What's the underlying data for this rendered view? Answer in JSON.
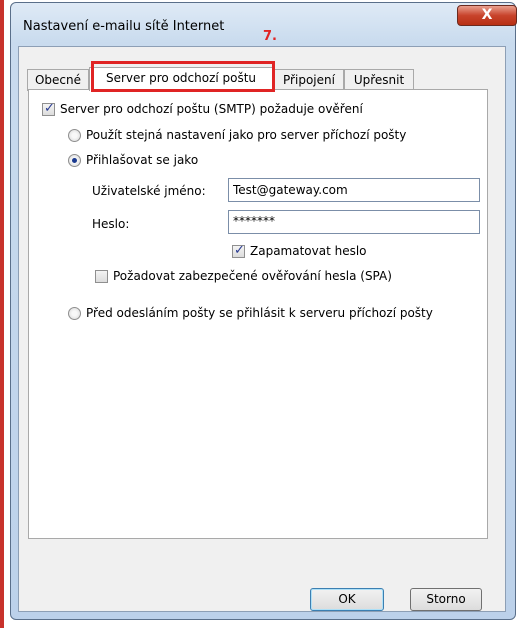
{
  "window": {
    "title": "Nastavení e-mailu sítě Internet",
    "step_annotation": "7.",
    "close_symbol": "X"
  },
  "tabs": [
    {
      "label": "Obecné",
      "active": false
    },
    {
      "label": "Server pro odchozí poštu",
      "active": true
    },
    {
      "label": "Připojení",
      "active": false
    },
    {
      "label": "Upřesnit",
      "active": false
    }
  ],
  "smtp_auth": {
    "label": "Server pro odchozí poštu (SMTP) požaduje ověření",
    "checked": true
  },
  "options": {
    "same_settings_label": "Použít stejná nastavení jako pro server příchozí pošty",
    "login_as_label": "Přihlašovat se jako",
    "before_send_label": "Před odesláním pošty se přihlásit k serveru příchozí pošty"
  },
  "credentials": {
    "username_label": "Uživatelské jméno:",
    "username_value": "Test@gateway.com",
    "password_label": "Heslo:",
    "password_value": "*******",
    "remember_label": "Zapamatovat heslo",
    "remember_checked": true,
    "spa_label": "Požadovat zabezpečené ověřování hesla (SPA)",
    "spa_checked": false
  },
  "buttons": {
    "ok": "OK",
    "cancel": "Storno"
  },
  "colors": {
    "highlight": "#e02424",
    "radio_selected": "#1b3a8f"
  }
}
